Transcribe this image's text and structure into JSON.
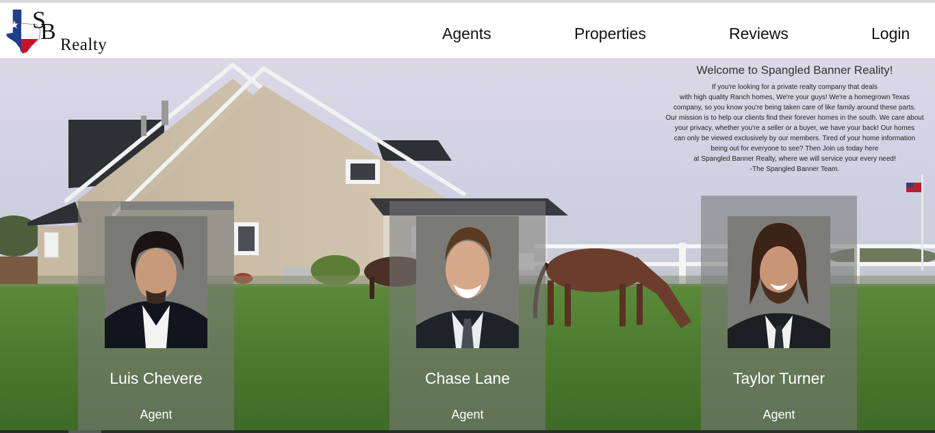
{
  "brand": {
    "logo_letters": [
      "S",
      "B"
    ],
    "wordmark": "Realty",
    "colors": {
      "flag_blue": "#1f3e8f",
      "flag_red": "#c8102e"
    }
  },
  "nav": {
    "items": [
      {
        "label": "Agents"
      },
      {
        "label": "Properties"
      },
      {
        "label": "Reviews"
      },
      {
        "label": "Login"
      }
    ]
  },
  "welcome": {
    "title": "Welcome to Spangled Banner Reality!",
    "lines": [
      "If you're looking for a private realty company that deals",
      "with high quality Ranch homes, We're your guys! We're a homegrown Texas",
      "company, so you know you're being taken care of like family around these parts.",
      "Our mission is to help our clients find their forever homes in the south. We care about",
      "your privacy, whether you're a seller or a buyer, we have your back! Our homes",
      "can only be viewed exclusively by our members. Tired of your home information",
      "being out for everyone to see? Then Join us today here",
      "at Spangled Banner Realty, where we will service your every need!",
      "-The Spangled Banner Team."
    ]
  },
  "agents": [
    {
      "name": "Luis Chevere",
      "role": "Agent"
    },
    {
      "name": "Chase Lane",
      "role": "Agent"
    },
    {
      "name": "Taylor Turner",
      "role": "Agent"
    }
  ],
  "hero": {
    "image": "ranch-house-with-horses-photo",
    "colors": {
      "grass": "#4f7a32",
      "siding": "#cbbfa9",
      "roof": "#2f3034"
    }
  }
}
